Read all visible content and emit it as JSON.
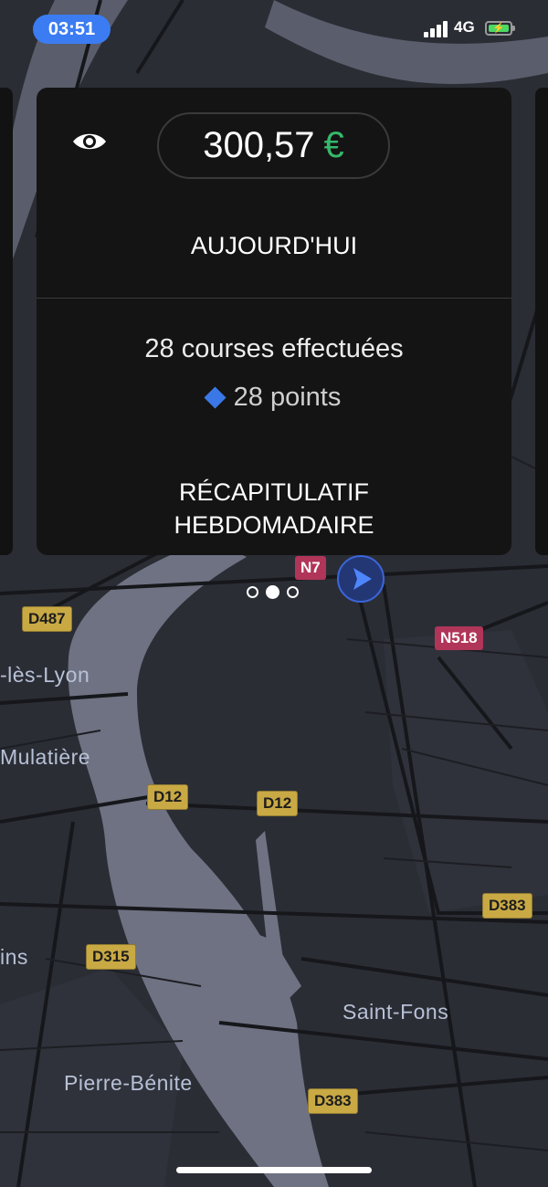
{
  "status_bar": {
    "time": "03:51",
    "network": "4G",
    "battery_icon": "battery-charging-icon",
    "signal_icon": "cellular-signal-icon"
  },
  "earnings_card": {
    "amount": "300,57",
    "currency": "€",
    "period": "AUJOURD'HUI",
    "trips": "28 courses effectuées",
    "points": "28 points",
    "weekly_summary_line1": "RÉCAPITULATIF",
    "weekly_summary_line2": "HEBDOMADAIRE",
    "visibility_icon": "eye-icon"
  },
  "pager": {
    "pages": 3,
    "active_index": 1
  },
  "map": {
    "road_labels": [
      "N7",
      "D487",
      "N518",
      "D12",
      "D12",
      "D383",
      "D315",
      "D383"
    ],
    "place_labels": [
      "-lès-Lyon",
      "Mulatière",
      "ins",
      "Saint-Fons",
      "Pierre-Bénite"
    ],
    "colors": {
      "background": "#2b2d35",
      "river": "#6f7282",
      "road": "#16171b",
      "d_shield": "#c9a944",
      "n_shield": "#b03559"
    }
  },
  "colors": {
    "accent_blue": "#3b7cf2",
    "currency_green": "#35b86b",
    "card_bg": "#141414"
  }
}
